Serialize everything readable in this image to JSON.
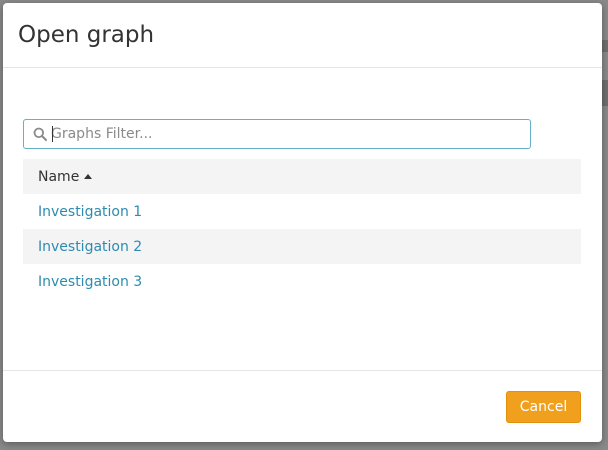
{
  "dialog": {
    "title": "Open graph"
  },
  "filter": {
    "placeholder": "Graphs Filter...",
    "value": ""
  },
  "table": {
    "column_header": "Name",
    "sort": "ascending",
    "rows": [
      {
        "name": "Investigation 1"
      },
      {
        "name": "Investigation 2"
      },
      {
        "name": "Investigation 3"
      }
    ]
  },
  "footer": {
    "cancel_label": "Cancel"
  },
  "colors": {
    "link": "#2e8bb0",
    "primary_button": "#f0a01d",
    "input_focus_border": "#66afc9"
  }
}
